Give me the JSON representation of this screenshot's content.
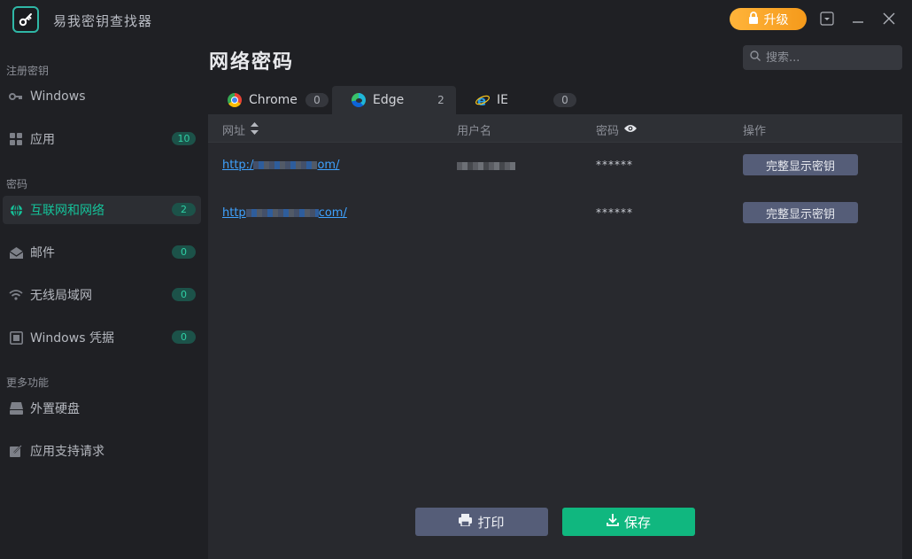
{
  "app": {
    "title": "易我密钥查找器",
    "upgrade_label": "升级"
  },
  "sidebar": {
    "sections": [
      {
        "label": "注册密钥"
      },
      {
        "label": "密码"
      },
      {
        "label": "更多功能"
      }
    ],
    "items": [
      {
        "label": "Windows",
        "icon": "key-icon"
      },
      {
        "label": "应用",
        "icon": "apps-grid-icon",
        "count": "10"
      },
      {
        "label": "互联网和网络",
        "icon": "globe-icon",
        "count": "2"
      },
      {
        "label": "邮件",
        "icon": "mail-icon",
        "count": "0"
      },
      {
        "label": "无线局域网",
        "icon": "wifi-icon",
        "count": "0"
      },
      {
        "label": "Windows 凭据",
        "icon": "vault-icon",
        "count": "0"
      },
      {
        "label": "外置硬盘",
        "icon": "drive-icon"
      },
      {
        "label": "应用支持请求",
        "icon": "edit-icon"
      }
    ]
  },
  "main": {
    "title": "网络密码",
    "search_placeholder": "搜索...",
    "tabs": [
      {
        "label": "Chrome",
        "count": "0",
        "icon": "chrome-icon"
      },
      {
        "label": "Edge",
        "count": "2",
        "icon": "edge-icon"
      },
      {
        "label": "IE",
        "count": "0",
        "icon": "ie-icon"
      }
    ],
    "columns": {
      "url": "网址",
      "username": "用户名",
      "password": "密码",
      "action": "操作"
    },
    "rows": [
      {
        "url_start": "http:/",
        "url_end": "om/",
        "password": "******",
        "action": "完整显示密钥"
      },
      {
        "url_start": "http",
        "url_end": "com/",
        "password": "******",
        "action": "完整显示密钥"
      }
    ]
  },
  "footer": {
    "print_label": "打印",
    "save_label": "保存"
  },
  "colors": {
    "background": "#1f2024",
    "panel": "#28292e",
    "accent": "#15c39a",
    "upgrade": "#f5a52a",
    "save": "#10b77f",
    "button": "#555d78",
    "link": "#3fa2ff"
  }
}
